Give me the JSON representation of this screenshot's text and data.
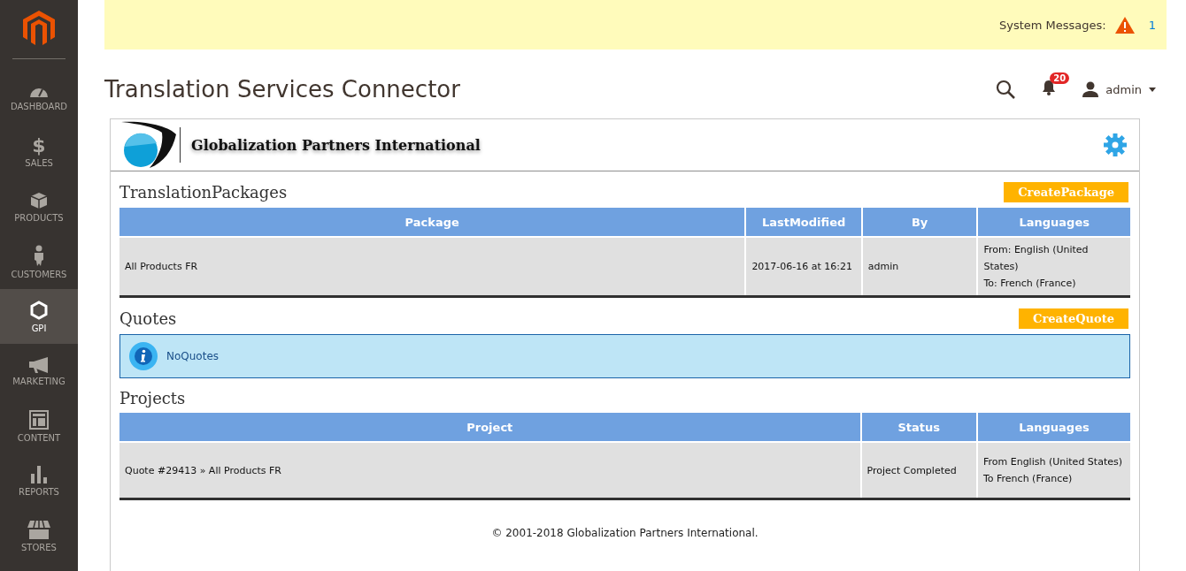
{
  "sidebar": {
    "items": [
      {
        "kind": "dashboard",
        "label": "DASHBOARD",
        "selected": false
      },
      {
        "kind": "sales",
        "symbol": "$",
        "label": "SALES",
        "selected": false
      },
      {
        "kind": "products",
        "label": "PRODUCTS",
        "selected": false
      },
      {
        "kind": "customers",
        "label": "CUSTOMERS",
        "selected": false
      },
      {
        "kind": "gpi",
        "label": "GPI",
        "selected": true
      },
      {
        "kind": "marketing",
        "label": "MARKETING",
        "selected": false
      },
      {
        "kind": "content",
        "label": "CONTENT",
        "selected": false
      },
      {
        "kind": "reports",
        "label": "REPORTS",
        "selected": false
      },
      {
        "kind": "stores",
        "label": "STORES",
        "selected": false
      }
    ]
  },
  "system_messages": {
    "label": "System Messages:",
    "count": "1"
  },
  "header": {
    "title": "Translation Services Connector",
    "notifications": "20",
    "user": "admin"
  },
  "panel": {
    "brand": "Globalization Partners International",
    "packages": {
      "title": "TranslationPackages",
      "button": "CreatePackage",
      "columns": [
        "Package",
        "LastModified",
        "By",
        "Languages"
      ],
      "rows": [
        {
          "cells": [
            "All Products FR",
            "2017-06-16 at 16:21",
            "admin"
          ],
          "languages": [
            "From: English (United States)",
            "To: French (France)"
          ]
        }
      ]
    },
    "quotes": {
      "title": "Quotes",
      "button": "CreateQuote",
      "message": "NoQuotes"
    },
    "projects": {
      "title": "Projects",
      "columns": [
        "Project",
        "Status",
        "Languages"
      ],
      "rows": [
        {
          "cells": [
            "Quote #29413 » All Products FR",
            "Project Completed"
          ],
          "languages": [
            "From English (United States)",
            "To French (France)"
          ]
        }
      ]
    },
    "footer": "© 2001-2018 Globalization Partners International."
  }
}
